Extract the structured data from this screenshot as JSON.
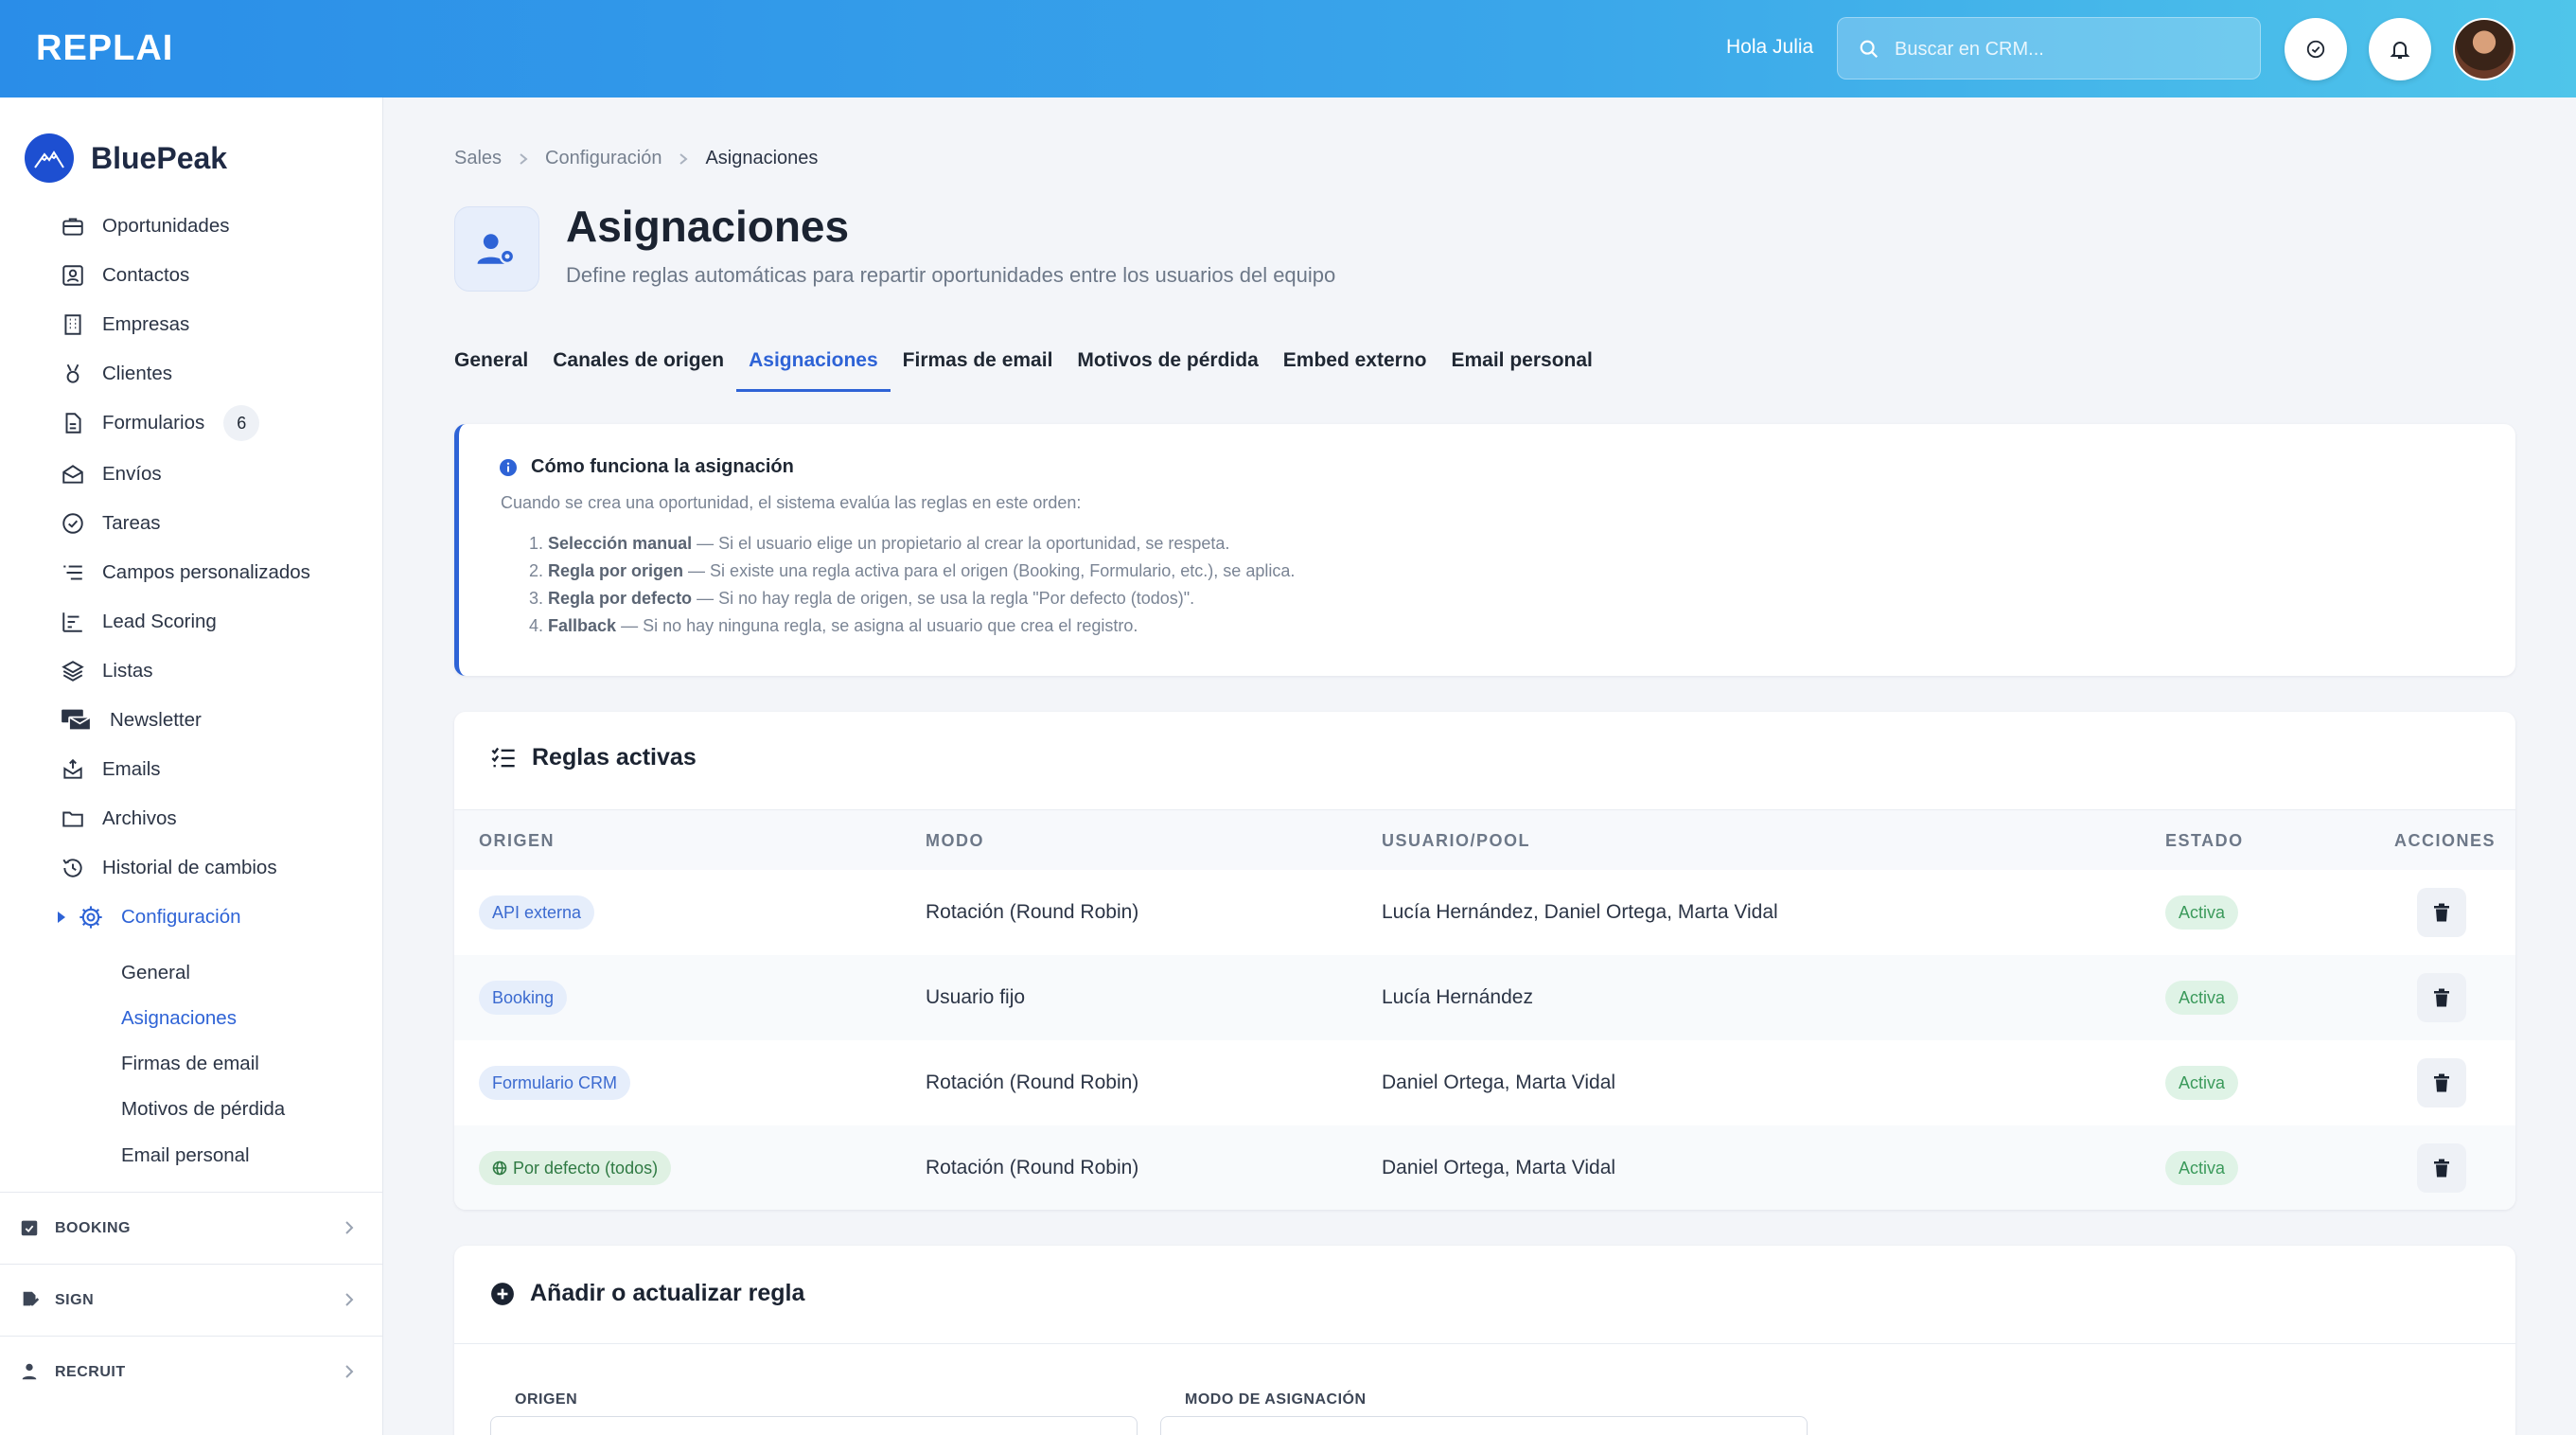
{
  "topbar": {
    "logo": "REPLAI",
    "greeting": "Hola Julia",
    "search_placeholder": "Buscar en CRM..."
  },
  "sidebar": {
    "brand": "BluePeak",
    "items": [
      {
        "label": "Oportunidades",
        "icon": "briefcase-icon"
      },
      {
        "label": "Contactos",
        "icon": "contact-card-icon"
      },
      {
        "label": "Empresas",
        "icon": "building-icon"
      },
      {
        "label": "Clientes",
        "icon": "medal-icon"
      },
      {
        "label": "Formularios",
        "icon": "document-icon",
        "badge": "6"
      },
      {
        "label": "Envíos",
        "icon": "envelope-open-icon"
      },
      {
        "label": "Tareas",
        "icon": "check-circle-icon"
      },
      {
        "label": "Campos personalizados",
        "icon": "list-icon"
      },
      {
        "label": "Lead Scoring",
        "icon": "bars-chart-icon"
      },
      {
        "label": "Listas",
        "icon": "layers-icon"
      },
      {
        "label": "Newsletter",
        "icon": "mail-stack-icon"
      },
      {
        "label": "Emails",
        "icon": "mail-out-icon"
      },
      {
        "label": "Archivos",
        "icon": "folder-icon"
      },
      {
        "label": "Historial de cambios",
        "icon": "history-icon"
      },
      {
        "label": "Configuración",
        "icon": "gear-icon"
      }
    ],
    "subitems": [
      "General",
      "Asignaciones",
      "Firmas de email",
      "Motivos de pérdida",
      "Email personal"
    ],
    "sections": [
      "BOOKING",
      "SIGN",
      "RECRUIT"
    ]
  },
  "breadcrumb": [
    "Sales",
    "Configuración",
    "Asignaciones"
  ],
  "page": {
    "title": "Asignaciones",
    "subtitle": "Define reglas automáticas para repartir oportunidades entre los usuarios del equipo"
  },
  "tabs": [
    "General",
    "Canales de origen",
    "Asignaciones",
    "Firmas de email",
    "Motivos de pérdida",
    "Embed externo",
    "Email personal"
  ],
  "info": {
    "title": "Cómo funciona la asignación",
    "intro": "Cuando se crea una oportunidad, el sistema evalúa las reglas en este orden:",
    "steps": [
      {
        "num": "1.",
        "bold": "Selección manual",
        "text": " — Si el usuario elige un propietario al crear la oportunidad, se respeta."
      },
      {
        "num": "2.",
        "bold": "Regla por origen",
        "text": " — Si existe una regla activa para el origen (Booking, Formulario, etc.), se aplica."
      },
      {
        "num": "3.",
        "bold": "Regla por defecto",
        "text": " — Si no hay regla de origen, se usa la regla \"Por defecto (todos)\"."
      },
      {
        "num": "4.",
        "bold": "Fallback",
        "text": " — Si no hay ninguna regla, se asigna al usuario que crea el registro."
      }
    ]
  },
  "rules": {
    "title": "Reglas activas",
    "columns": [
      "ORIGEN",
      "MODO",
      "USUARIO/POOL",
      "ESTADO",
      "ACCIONES"
    ],
    "rows": [
      {
        "origin": "API externa",
        "mode": "Rotación (Round Robin)",
        "users": "Lucía Hernández, Daniel Ortega, Marta Vidal",
        "status": "Activa"
      },
      {
        "origin": "Booking",
        "mode": "Usuario fijo",
        "users": "Lucía Hernández",
        "status": "Activa"
      },
      {
        "origin": "Formulario CRM",
        "mode": "Rotación (Round Robin)",
        "users": "Daniel Ortega, Marta Vidal",
        "status": "Activa"
      },
      {
        "origin": "Por defecto (todos)",
        "mode": "Rotación (Round Robin)",
        "users": "Daniel Ortega, Marta Vidal",
        "status": "Activa"
      }
    ]
  },
  "add_rule": {
    "title": "Añadir o actualizar regla",
    "origin_label": "ORIGEN",
    "mode_label": "MODO DE ASIGNACIÓN"
  },
  "colors": {
    "accent": "#2e63d6",
    "topbar_start": "#2a8de8",
    "topbar_end": "#4fc5ea",
    "status_green": "#3b9a5b"
  }
}
